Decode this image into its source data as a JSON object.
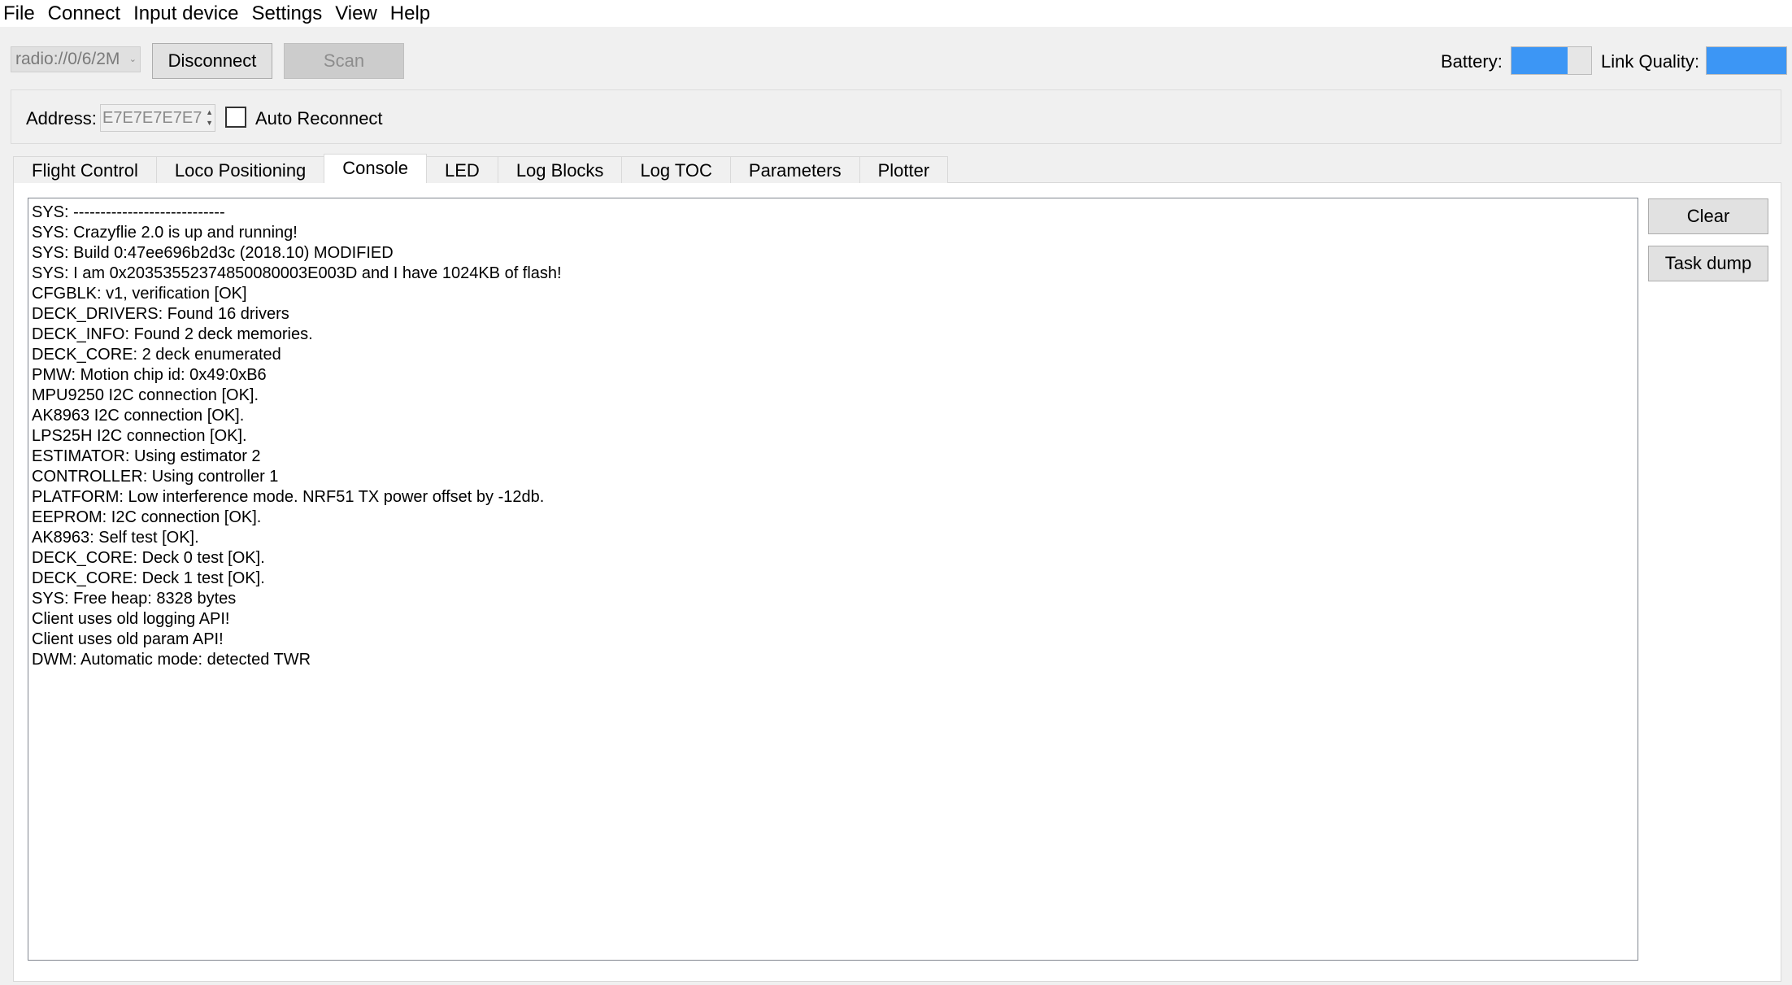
{
  "menu": [
    "File",
    "Connect",
    "Input device",
    "Settings",
    "View",
    "Help"
  ],
  "toolbar": {
    "uri": "radio://0/6/2M",
    "disconnect": "Disconnect",
    "scan": "Scan",
    "battery_label": "Battery:",
    "battery_level": 0.7,
    "link_quality_label": "Link Quality:",
    "link_quality_level": 1.0
  },
  "address": {
    "label": "Address:",
    "value": "E7E7E7E7E7",
    "auto_reconnect": "Auto Reconnect",
    "auto_reconnect_checked": false
  },
  "tabs": [
    "Flight Control",
    "Loco Positioning",
    "Console",
    "LED",
    "Log Blocks",
    "Log TOC",
    "Parameters",
    "Plotter"
  ],
  "active_tab": "Console",
  "console": {
    "lines": [
      "SYS: ----------------------------",
      "SYS: Crazyflie 2.0 is up and running!",
      "SYS: Build 0:47ee696b2d3c (2018.10) MODIFIED",
      "SYS: I am 0x20353552374850080003E003D and I have 1024KB of flash!",
      "CFGBLK: v1, verification [OK]",
      "DECK_DRIVERS: Found 16 drivers",
      "DECK_INFO: Found 2 deck memories.",
      "DECK_CORE: 2 deck enumerated",
      "PMW: Motion chip id: 0x49:0xB6",
      "MPU9250 I2C connection [OK].",
      "AK8963 I2C connection [OK].",
      "LPS25H I2C connection [OK].",
      "ESTIMATOR: Using estimator 2",
      "CONTROLLER: Using controller 1",
      "PLATFORM: Low interference mode. NRF51 TX power offset by -12db.",
      "EEPROM: I2C connection [OK].",
      "AK8963: Self test [OK].",
      "DECK_CORE: Deck 0 test [OK].",
      "DECK_CORE: Deck 1 test [OK].",
      "SYS: Free heap: 8328 bytes",
      "Client uses old logging API!",
      "Client uses old param API!",
      "DWM: Automatic mode: detected TWR"
    ],
    "clear": "Clear",
    "task_dump": "Task dump"
  },
  "colors": {
    "bar_fill": "#3c96f5"
  }
}
